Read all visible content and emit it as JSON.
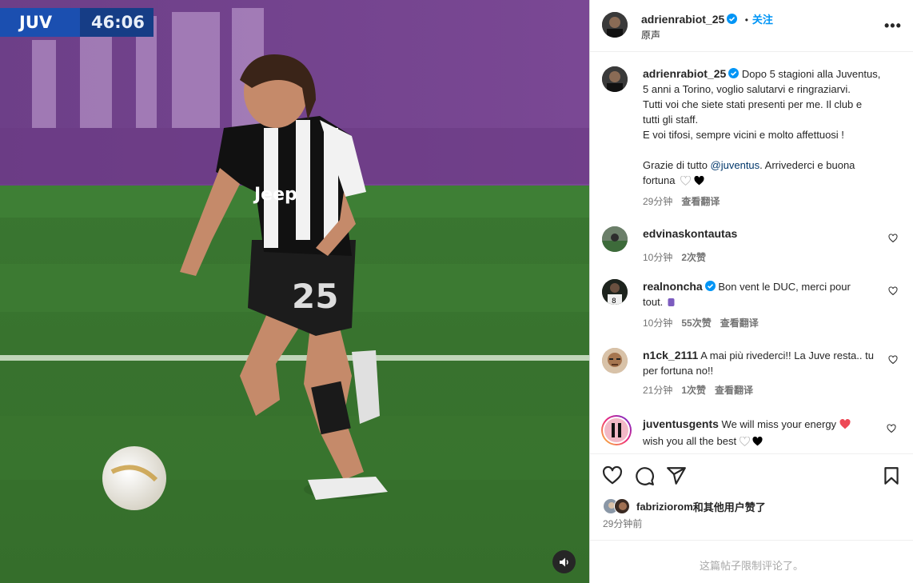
{
  "video": {
    "scoreboard_team": "JUV",
    "scoreboard_clock": "46:06"
  },
  "header": {
    "username": "adrienrabiot_25",
    "dot": "•",
    "follow_label": "关注",
    "audio_label": "原声",
    "more_label": "•••"
  },
  "caption": {
    "username": "adrienrabiot_25",
    "lines": [
      "Dopo 5 stagioni alla Juventus,",
      "5 anni a Torino, voglio salutarvi e ringraziarvi.",
      "Tutti voi che siete stati presenti per me. Il club e",
      "tutti gli staff.",
      "E voi tifosi, sempre vicini e molto affettuosi !"
    ],
    "line_thanks_prefix": "Grazie di tutto ",
    "mention": "@juventus",
    "line_thanks_suffix": ". Arrivederci e buona",
    "line_last": "fortuna",
    "time": "29分钟",
    "translate": "查看翻译"
  },
  "comments": [
    {
      "username": "edvinaskontautas",
      "text": "",
      "time": "10分钟",
      "likes": "2次赞",
      "translate": ""
    },
    {
      "username": "realnoncha",
      "text": "Bon vent le DUC, merci pour",
      "text2": "tout. ",
      "time": "10分钟",
      "likes": "55次赞",
      "translate": "查看翻译"
    },
    {
      "username": "n1ck_2111",
      "text": "A mai più rivederci!! La Juve resta.. tu",
      "text2": "per fortuna no!!",
      "time": "21分钟",
      "likes": "1次赞",
      "translate": "查看翻译"
    },
    {
      "username": "juventusgents",
      "text": "We will miss your energy ",
      "text2": "wish you all the best ",
      "time": "",
      "likes": "",
      "translate": ""
    }
  ],
  "actions": {
    "liked_by_user": "fabriziorom",
    "liked_by_suffix": "和其他用户赞了",
    "posted_time": "29分钟前"
  },
  "footer": {
    "restricted_text": "这篇帖子限制评论了。"
  },
  "colors": {
    "accent": "#0095f6",
    "verified": "#0095f6",
    "heart_red": "#ed4956"
  }
}
